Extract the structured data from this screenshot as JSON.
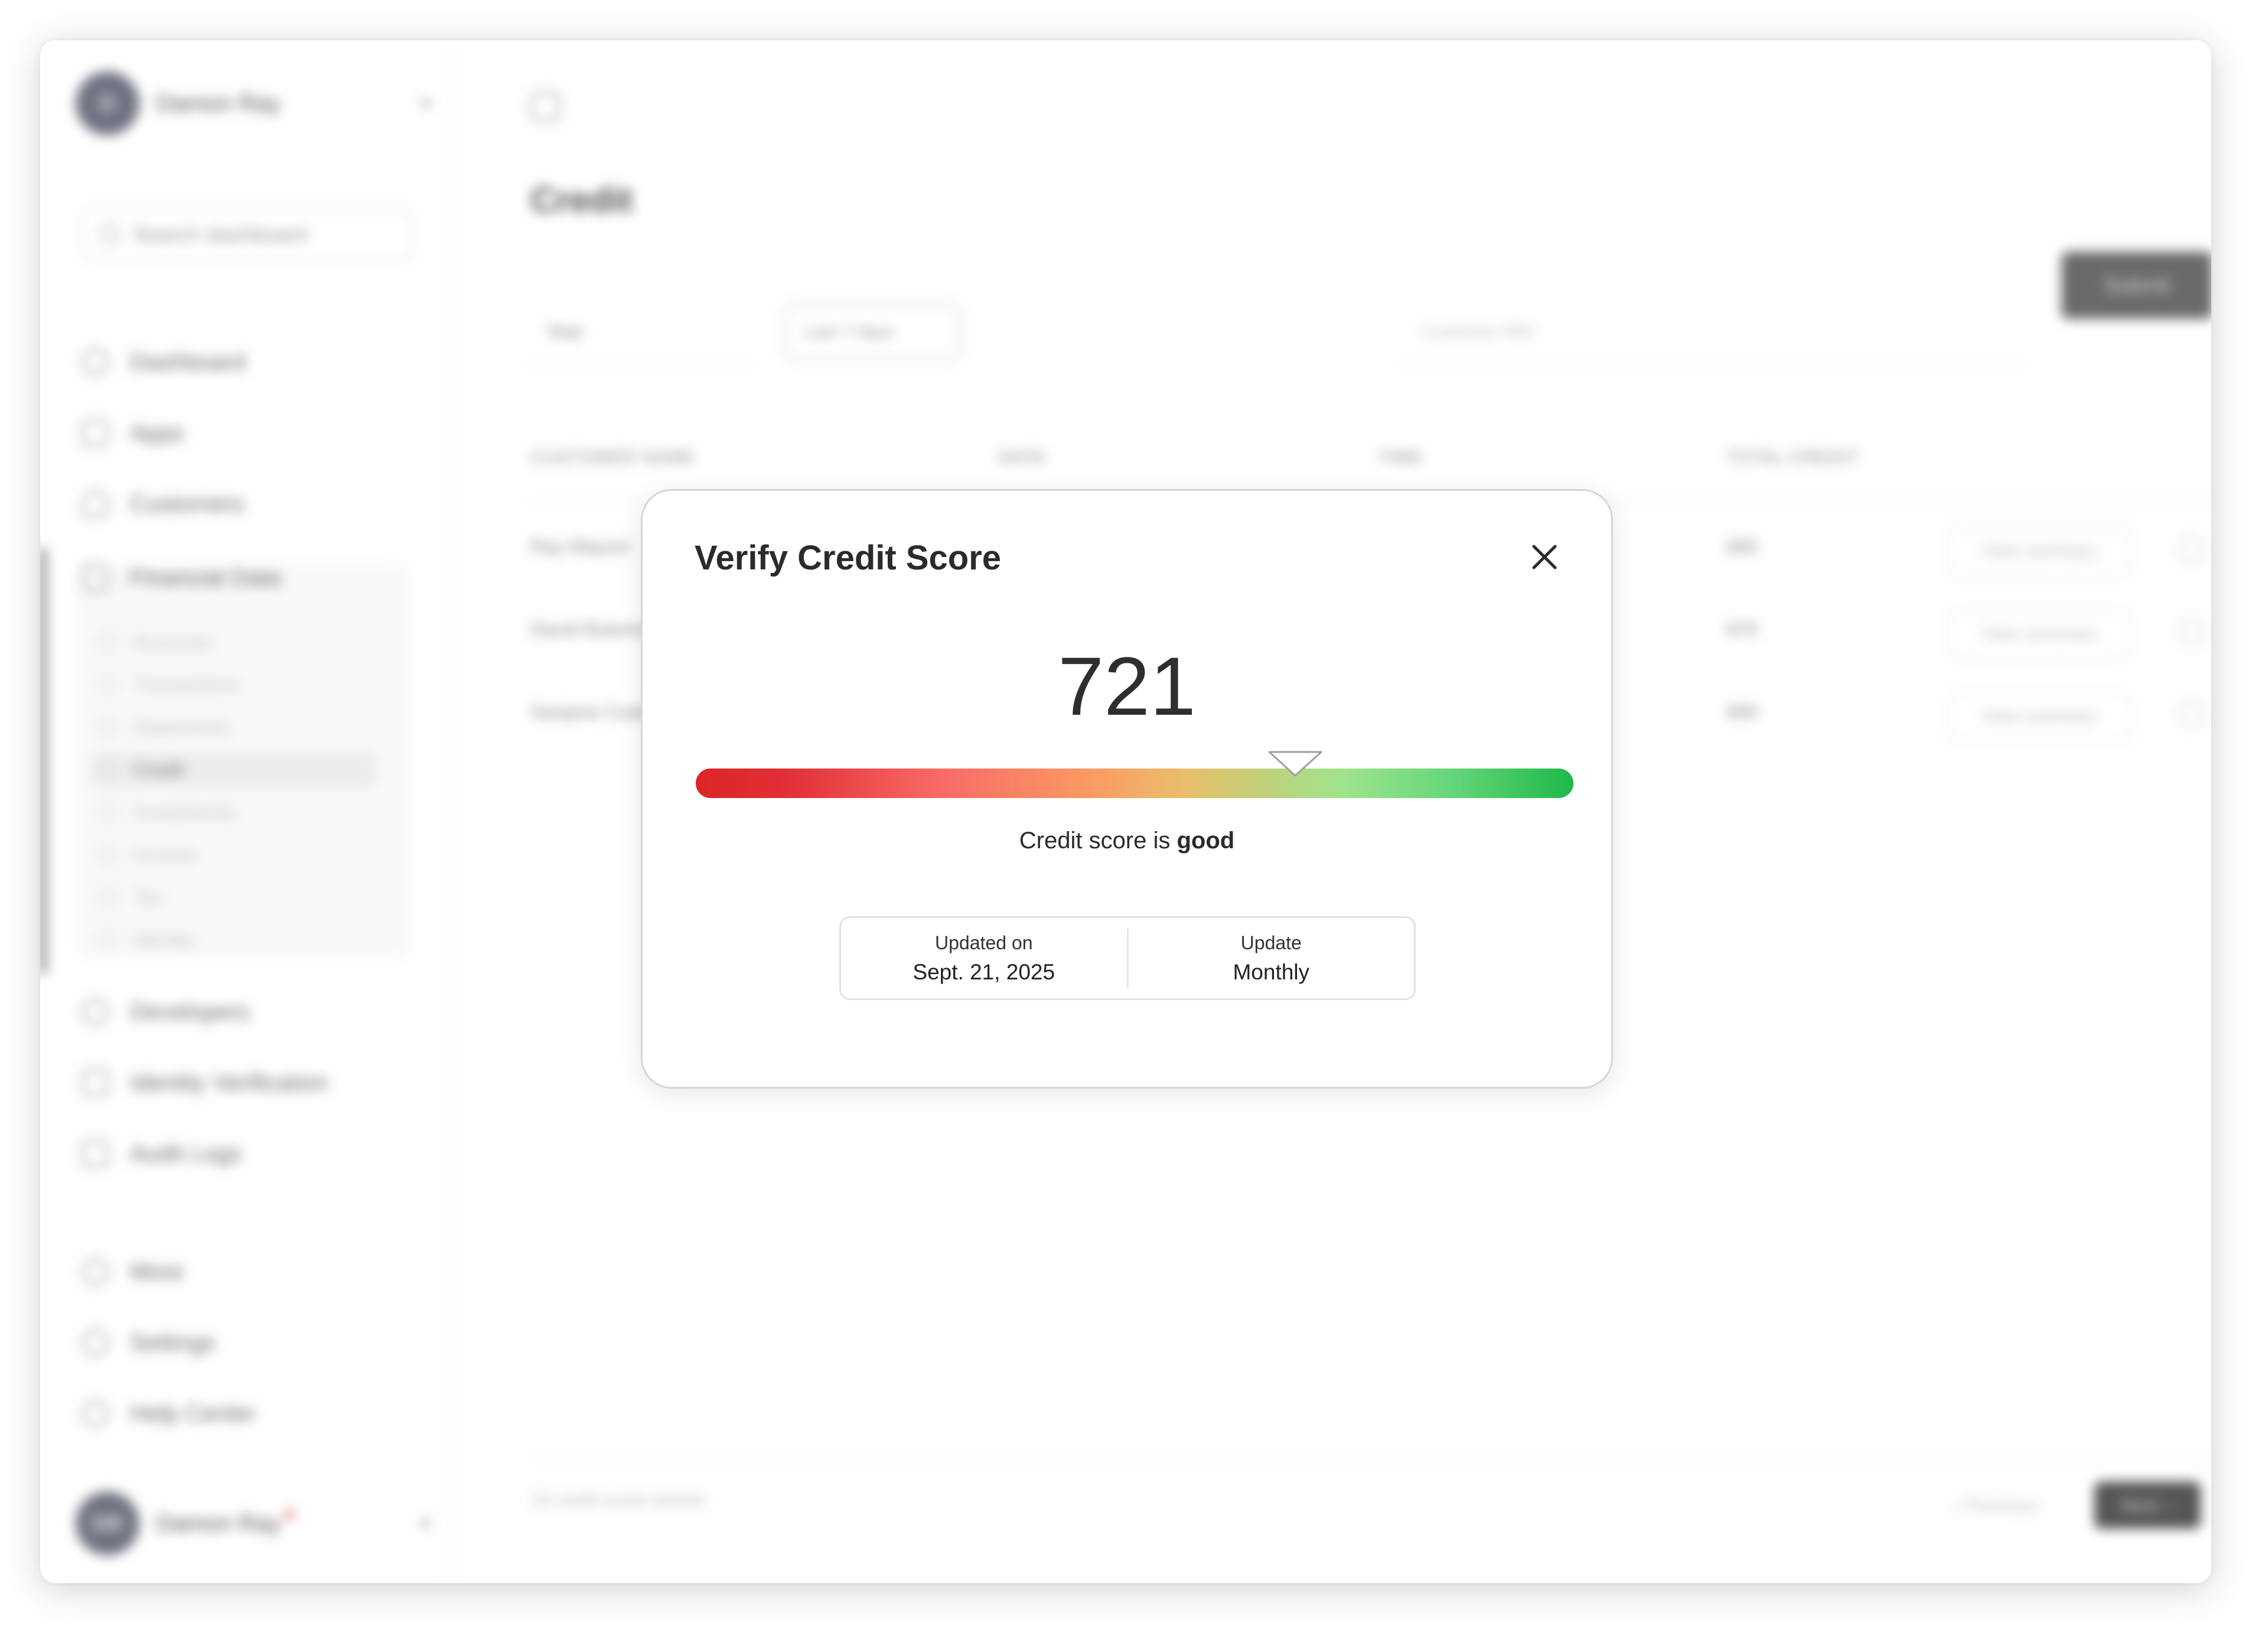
{
  "background_app": {
    "user": {
      "initials": "D",
      "name": "Damon Ray"
    },
    "search_placeholder": "Search dashboard",
    "nav": [
      {
        "label": "Dashboard",
        "icon": "circle-icon"
      },
      {
        "label": "Apps",
        "icon": "grid-icon"
      },
      {
        "label": "Customers",
        "icon": "user-icon"
      },
      {
        "label": "Financial Data",
        "icon": "chart-icon"
      }
    ],
    "sub_nav": [
      "Accounts",
      "Transactions",
      "Statements",
      "Credit",
      "Investments",
      "Income",
      "Tax",
      "Identity"
    ],
    "nav_bottom": [
      {
        "label": "Developers",
        "icon": "code-icon"
      },
      {
        "label": "Identity Verification",
        "icon": "id-icon"
      },
      {
        "label": "Audit Logs",
        "icon": "document-icon"
      }
    ],
    "nav_footer": [
      {
        "label": "More",
        "icon": "more-icon"
      },
      {
        "label": "Settings",
        "icon": "gear-icon"
      },
      {
        "label": "Help Center",
        "icon": "help-icon"
      }
    ],
    "footer_user": {
      "initials": "DR",
      "name": "Damon Ray"
    },
    "page_title": "Credit",
    "filters": {
      "year": "Year",
      "range": "Last 7 days",
      "search_placeholder": "Customer RIN",
      "submit": "Submit"
    },
    "table": {
      "headers": [
        "CUSTOMER NAME",
        "DATE",
        "TIME",
        "TOTAL CREDIT"
      ],
      "rows": [
        {
          "name": "Ray Mayoni",
          "score": "665",
          "action": "View summary"
        },
        {
          "name": "David Bukenda",
          "score": "670",
          "action": "View summary"
        },
        {
          "name": "Sanjane Coakley",
          "score": "690",
          "action": "View summary"
        }
      ]
    },
    "footer_text": "15 credit score entries",
    "pagination": {
      "prev": "Previous",
      "next": "Next"
    }
  },
  "modal": {
    "title": "Verify Credit Score",
    "close_icon": "close-icon",
    "score": "721",
    "score_position": 0.683,
    "score_label_prefix": "Credit score is",
    "score_label_value": "good",
    "updated_on_label": "Updated on",
    "updated_on_value": "Sept. 21, 2025",
    "update_label": "Update",
    "update_value": "Monthly"
  }
}
